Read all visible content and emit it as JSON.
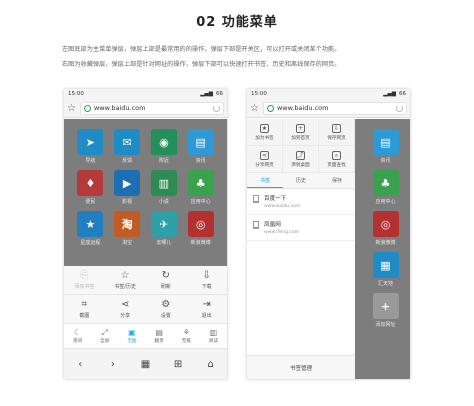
{
  "page": {
    "title": "02 功能菜单",
    "desc_line1": "左图底部为主菜单弹层，弹层上部是最常用的的操作，弹层下部是开关区，可以打开或关闭某个功能。",
    "desc_line2": "右图为收藏弹层，弹层上部是针对网址的操作，弹层下部可以快速打开书签、历史和离线保存的网页。"
  },
  "phone": {
    "time": "15:00",
    "battery": "66",
    "url": "www.baidu.com",
    "star_icon": "☆"
  },
  "colors": {
    "accent": "#2ba8e0",
    "secure": "#2aa14a",
    "overlay": "#7d7d7d"
  },
  "sites_left": [
    {
      "label": "导航",
      "icon": "➤",
      "color": "#1f8cc6"
    },
    {
      "label": "反馈",
      "icon": "✉",
      "color": "#1f8cc6"
    },
    {
      "label": "附近",
      "icon": "◉",
      "color": "#238f5b"
    },
    {
      "label": "资讯",
      "icon": "▤",
      "color": "#2d9ad6"
    },
    {
      "label": "便民",
      "icon": "♦",
      "color": "#b63a3a"
    },
    {
      "label": "影视",
      "icon": "▶",
      "color": "#1d6fb5"
    },
    {
      "label": "小说",
      "icon": "▥",
      "color": "#2d8c54"
    },
    {
      "label": "应用中心",
      "icon": "♣",
      "color": "#3aa14f"
    },
    {
      "label": "星座运程",
      "icon": "★",
      "color": "#1f7fc0"
    },
    {
      "label": "淘宝",
      "icon": "淘",
      "color": "#c45a24"
    },
    {
      "label": "去哪儿",
      "icon": "✈",
      "color": "#2ea0a8"
    },
    {
      "label": "新浪微博",
      "icon": "◎",
      "color": "#b53030"
    }
  ],
  "sites_right": [
    {
      "label": "资讯",
      "icon": "▤",
      "color": "#2d9ad6"
    },
    {
      "label": "应用中心",
      "icon": "♣",
      "color": "#3aa14f"
    },
    {
      "label": "新浪微博",
      "icon": "◎",
      "color": "#b53030"
    },
    {
      "label": "汇天地",
      "icon": "▦",
      "color": "#1f8cc6"
    },
    {
      "label": "添加网址",
      "icon": "+",
      "color": "#9a9a9a"
    }
  ],
  "menu_top": [
    {
      "label": "添加书签",
      "icon": "⎘",
      "disabled": true
    },
    {
      "label": "书签/历史",
      "icon": "☆",
      "disabled": false
    },
    {
      "label": "刷新",
      "icon": "↻",
      "disabled": false
    },
    {
      "label": "下载",
      "icon": "⇩",
      "disabled": false
    }
  ],
  "menu_bottom": [
    {
      "label": "截图",
      "icon": "⌗"
    },
    {
      "label": "分享",
      "icon": "⋖"
    },
    {
      "label": "设置",
      "icon": "⚙"
    },
    {
      "label": "退出",
      "icon": "⇥"
    }
  ],
  "menu_modes": [
    {
      "label": "夜间",
      "icon": "☾",
      "active": false
    },
    {
      "label": "全屏",
      "icon": "⤢",
      "active": false
    },
    {
      "label": "无图",
      "icon": "▣",
      "active": true
    },
    {
      "label": "翻页",
      "icon": "▤",
      "active": false
    },
    {
      "label": "无痕",
      "icon": "⚘",
      "active": false
    },
    {
      "label": "阅读",
      "icon": "▥",
      "active": false
    }
  ],
  "nav": [
    {
      "label": "back",
      "icon": "‹"
    },
    {
      "label": "forward",
      "icon": "›"
    },
    {
      "label": "tabs",
      "icon": "▦"
    },
    {
      "label": "add",
      "icon": "⊞"
    },
    {
      "label": "home",
      "icon": "⌂"
    }
  ],
  "fav_actions": [
    {
      "label": "加为书签",
      "icon": "★"
    },
    {
      "label": "加到首页",
      "icon": "+"
    },
    {
      "label": "保存网页",
      "icon": "⇩"
    },
    {
      "label": "分享网页",
      "icon": "⋖"
    },
    {
      "label": "添到桌面",
      "icon": "⤴"
    },
    {
      "label": "页面查找",
      "icon": "⌕"
    }
  ],
  "fav_tabs": [
    "书签",
    "历史",
    "保存"
  ],
  "bookmarks": [
    {
      "title": "百度一下",
      "url": "www.baidu.com"
    },
    {
      "title": "凤凰网",
      "url": "www.ifeng.com"
    }
  ],
  "fav_manage": "书签管理"
}
